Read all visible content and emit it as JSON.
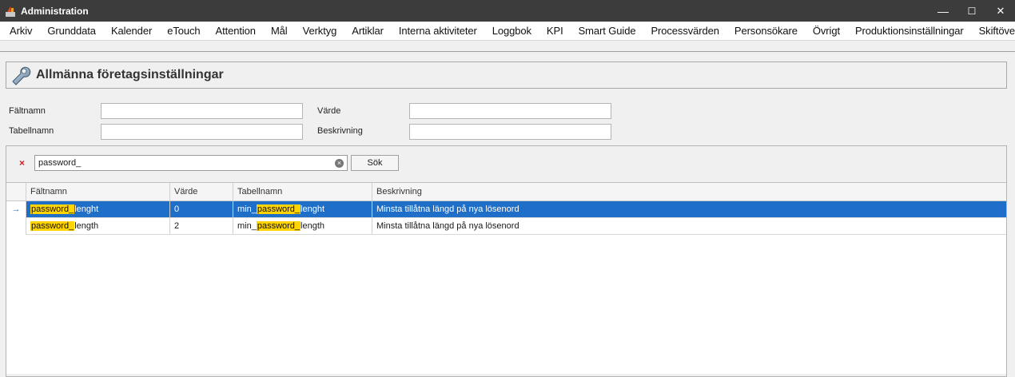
{
  "window": {
    "title": "Administration",
    "minimize": "—",
    "maximize": "☐",
    "close": "✕"
  },
  "menu": [
    "Arkiv",
    "Grunddata",
    "Kalender",
    "eTouch",
    "Attention",
    "Mål",
    "Verktyg",
    "Artiklar",
    "Interna aktiviteter",
    "Loggbok",
    "KPI",
    "Smart Guide",
    "Processvärden",
    "Personsökare",
    "Övrigt",
    "Produktionsinställningar",
    "Skiftöverlämning"
  ],
  "header": {
    "title": "Allmänna företagsinställningar"
  },
  "filters": {
    "faltnamn_label": "Fältnamn",
    "tabellnamn_label": "Tabellnamn",
    "varde_label": "Värde",
    "beskrivning_label": "Beskrivning",
    "faltnamn_value": "",
    "tabellnamn_value": "",
    "varde_value": "",
    "beskrivning_value": ""
  },
  "search": {
    "clear": "×",
    "value": "password_",
    "button": "Sök"
  },
  "grid": {
    "columns": [
      "Fältnamn",
      "Värde",
      "Tabellnamn",
      "Beskrivning"
    ],
    "rows": [
      {
        "faltnamn_hl": "password_",
        "faltnamn_rest": "lenght",
        "varde": "0",
        "tabell_pre": "min_",
        "tabell_hl": "password_",
        "tabell_rest": "lenght",
        "beskrivning": "Minsta tillåtna längd på nya lösenord"
      },
      {
        "faltnamn_hl": "password_",
        "faltnamn_rest": "length",
        "varde": "2",
        "tabell_pre": "min_",
        "tabell_hl": "password_",
        "tabell_rest": "length",
        "beskrivning": "Minsta tillåtna längd på nya lösenord"
      }
    ]
  },
  "colors": {
    "selection": "#1f6fc9",
    "highlight": "#ffd400",
    "titlebar": "#3c3c3c"
  }
}
